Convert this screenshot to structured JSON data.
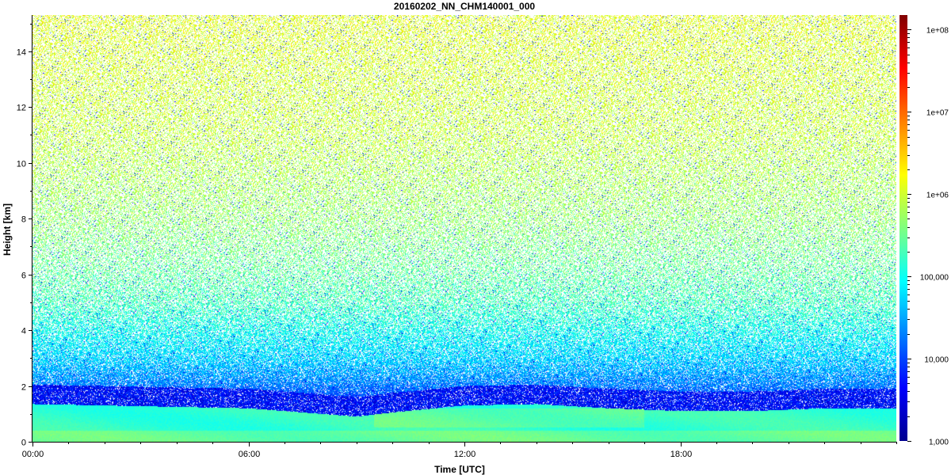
{
  "chart_data": {
    "type": "heatmap",
    "title": "20160202_NN_CHM140001_000",
    "xlabel": "Time [UTC]",
    "ylabel": "Height [km]",
    "x_ticks": [
      "00:00",
      "06:00",
      "12:00",
      "18:00"
    ],
    "x_tick_hours": [
      0,
      6,
      12,
      18
    ],
    "xlim_hours": [
      0,
      24
    ],
    "y_ticks": [
      "0",
      "2",
      "4",
      "6",
      "8",
      "10",
      "12",
      "14"
    ],
    "y_tick_values": [
      0,
      2,
      4,
      6,
      8,
      10,
      12,
      14
    ],
    "ylim_km": [
      0,
      15.3
    ],
    "colorbar": {
      "scale": "log",
      "range": [
        1000,
        150000000
      ],
      "tick_values": [
        1000,
        10000,
        100000,
        1000000,
        10000000,
        100000000
      ],
      "tick_labels": [
        "1,000",
        "10,000",
        "100,000",
        "1e+06",
        "1e+07",
        "1e+08"
      ],
      "colormap": "jet"
    },
    "surface_layer": {
      "top_km_by_hour": [
        [
          0,
          1.35
        ],
        [
          2,
          1.3
        ],
        [
          4,
          1.25
        ],
        [
          6,
          1.2
        ],
        [
          8,
          1.0
        ],
        [
          9,
          0.9
        ],
        [
          10,
          1.05
        ],
        [
          12,
          1.3
        ],
        [
          14,
          1.35
        ],
        [
          16,
          1.2
        ],
        [
          18,
          1.1
        ],
        [
          20,
          1.1
        ],
        [
          22,
          1.2
        ],
        [
          24,
          1.2
        ]
      ],
      "log_value_in_layer": 5.2
    },
    "background_profile": [
      {
        "height_km": 1.4,
        "log_value": 3.9
      },
      {
        "height_km": 2.0,
        "log_value": 4.3
      },
      {
        "height_km": 3.0,
        "log_value": 4.75
      },
      {
        "height_km": 5.0,
        "log_value": 5.3
      },
      {
        "height_km": 8.0,
        "log_value": 5.7
      },
      {
        "height_km": 11.0,
        "log_value": 5.95
      },
      {
        "height_km": 15.3,
        "log_value": 6.1
      }
    ]
  }
}
